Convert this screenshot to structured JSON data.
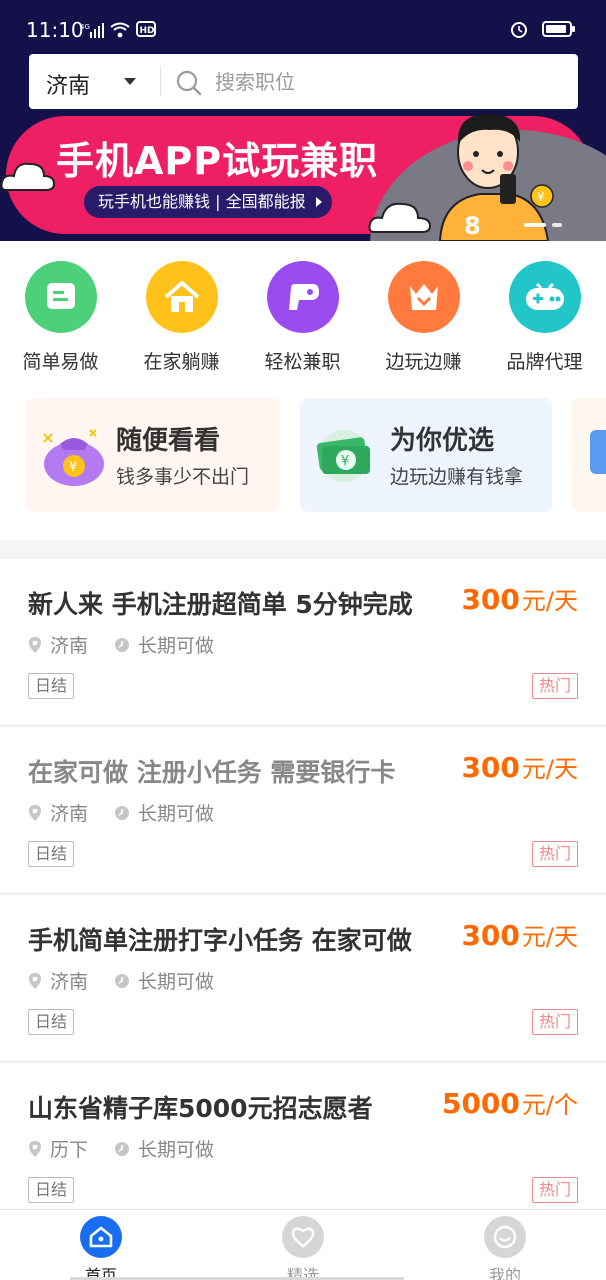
{
  "status": {
    "time": "11:10",
    "net": "4G",
    "hd": "HD"
  },
  "search": {
    "city": "济南",
    "placeholder": "搜索职位"
  },
  "banner": {
    "title": "手机APP试玩兼职",
    "subtitle": "玩手机也能赚钱 | 全国都能报",
    "badge": "8"
  },
  "categories": [
    {
      "label": "简单易做",
      "icon": "note-icon",
      "color": "#4cd07a"
    },
    {
      "label": "在家躺赚",
      "icon": "home-icon",
      "color": "#ffc21a"
    },
    {
      "label": "轻松兼职",
      "icon": "gamepad-icon",
      "color": "#9a4cf0"
    },
    {
      "label": "边玩边赚",
      "icon": "crown-icon",
      "color": "#ff7a3c"
    },
    {
      "label": "品牌代理",
      "icon": "controller-icon",
      "color": "#23c6c8"
    }
  ],
  "promos": [
    {
      "title": "随便看看",
      "subtitle": "钱多事少不出门",
      "icon": "money-bag-icon"
    },
    {
      "title": "为你优选",
      "subtitle": "边玩边赚有钱拿",
      "icon": "cash-stack-icon"
    }
  ],
  "jobs": [
    {
      "title": "新人来 手机注册超简单 5分钟完成",
      "pay": "300",
      "unit": "元/天",
      "location": "济南",
      "duration": "长期可做",
      "tag": "日结",
      "badge": "热门"
    },
    {
      "title": "在家可做 注册小任务 需要银行卡",
      "pay": "300",
      "unit": "元/天",
      "location": "济南",
      "duration": "长期可做",
      "tag": "日结",
      "badge": "热门"
    },
    {
      "title": "手机简单注册打字小任务 在家可做",
      "pay": "300",
      "unit": "元/天",
      "location": "济南",
      "duration": "长期可做",
      "tag": "日结",
      "badge": "热门"
    },
    {
      "title": "山东省精子库5000元招志愿者",
      "pay": "5000",
      "unit": "元/个",
      "location": "历下",
      "duration": "长期可做",
      "tag": "日结",
      "badge": "热门"
    }
  ],
  "nav": [
    {
      "label": "首页",
      "icon": "home-icon",
      "active": true
    },
    {
      "label": "精选",
      "icon": "heart-icon",
      "active": false
    },
    {
      "label": "我的",
      "icon": "smiley-icon",
      "active": false
    }
  ],
  "colors": {
    "header": "#14104a",
    "accent": "#ff6a00",
    "bannerPink": "#ee1f62",
    "navActive": "#1a6cf0"
  }
}
